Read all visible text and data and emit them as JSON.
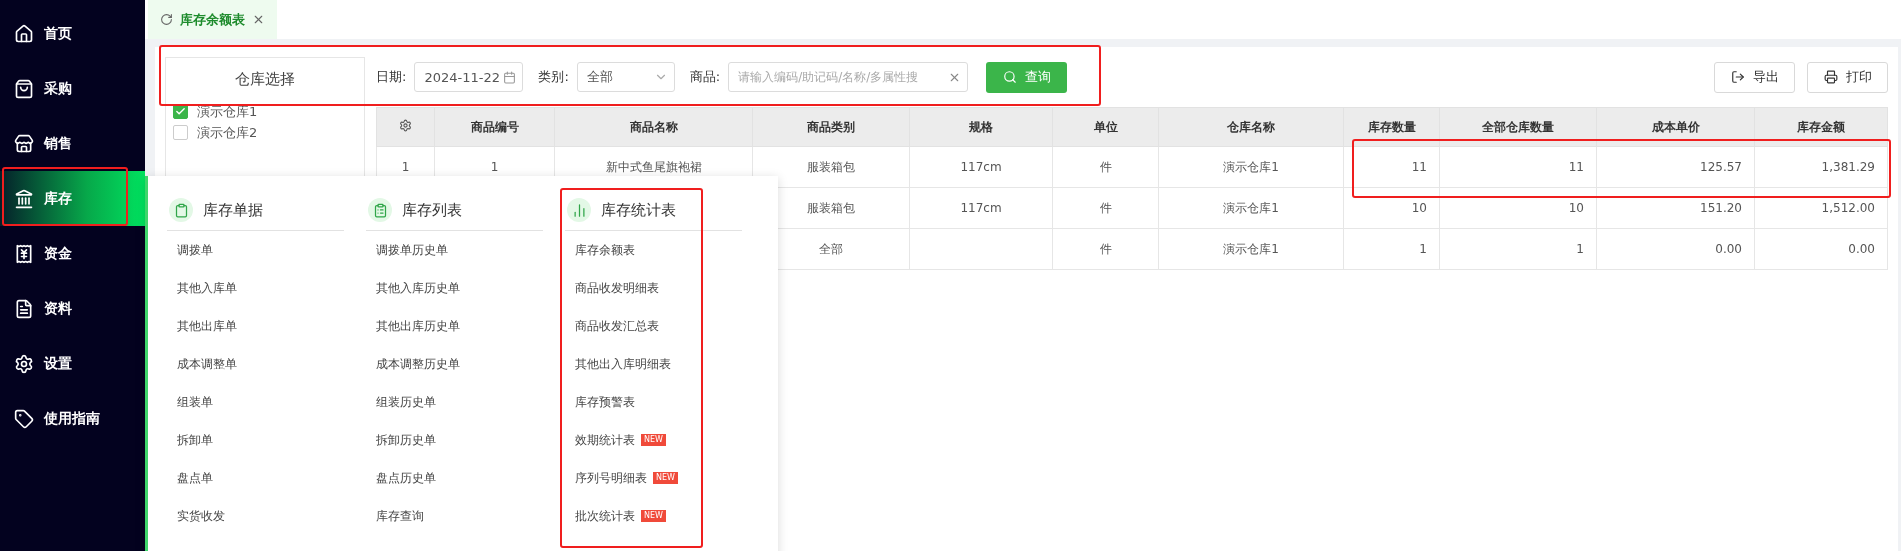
{
  "sidebar": {
    "items": [
      {
        "label": "首页",
        "selected": false
      },
      {
        "label": "采购",
        "selected": false
      },
      {
        "label": "销售",
        "selected": false
      },
      {
        "label": "库存",
        "selected": true
      },
      {
        "label": "资金",
        "selected": false
      },
      {
        "label": "资料",
        "selected": false
      },
      {
        "label": "设置",
        "selected": false
      },
      {
        "label": "使用指南",
        "selected": false
      }
    ]
  },
  "tabs": [
    {
      "label": "库存余额表",
      "selected": true
    }
  ],
  "warehouse_panel": {
    "title": "仓库选择",
    "items": [
      {
        "label": "演示仓库1",
        "checked": true
      },
      {
        "label": "演示仓库2",
        "checked": false
      }
    ]
  },
  "filters": {
    "date_label": "日期:",
    "date_value": "2024-11-22",
    "category_label": "类别:",
    "category_value": "全部",
    "product_label": "商品:",
    "product_placeholder": "请输入编码/助记码/名称/多属性搜"
  },
  "buttons": {
    "search": "查询",
    "export": "导出",
    "print": "打印"
  },
  "table": {
    "columns": [
      "商品编号",
      "商品名称",
      "商品类别",
      "规格",
      "单位",
      "仓库名称",
      "库存数量",
      "全部仓库数量",
      "成本单价",
      "库存金额"
    ],
    "rows": [
      {
        "row_number": "1",
        "cells": [
          "1",
          "新中式鱼尾旗袍裙",
          "服装箱包",
          "117cm",
          "件",
          "演示仓库1",
          "11",
          "11",
          "125.57",
          "1,381.29"
        ]
      },
      {
        "cells": [
          null,
          null,
          "服装箱包",
          "117cm",
          "件",
          "演示仓库1",
          "10",
          "10",
          "151.20",
          "1,512.00"
        ]
      },
      {
        "cells": [
          null,
          null,
          "全部",
          null,
          "件",
          "演示仓库1",
          "1",
          "1",
          "0.00",
          "0.00"
        ]
      }
    ]
  },
  "menu": {
    "sections": [
      {
        "title": "库存单据",
        "items": [
          {
            "label": "调拨单"
          },
          {
            "label": "其他入库单"
          },
          {
            "label": "其他出库单"
          },
          {
            "label": "成本调整单"
          },
          {
            "label": "组装单"
          },
          {
            "label": "拆卸单"
          },
          {
            "label": "盘点单"
          },
          {
            "label": "实货收发"
          }
        ]
      },
      {
        "title": "库存列表",
        "items": [
          {
            "label": "调拨单历史单"
          },
          {
            "label": "其他入库历史单"
          },
          {
            "label": "其他出库历史单"
          },
          {
            "label": "成本调整历史单"
          },
          {
            "label": "组装历史单"
          },
          {
            "label": "拆卸历史单"
          },
          {
            "label": "盘点历史单"
          },
          {
            "label": "库存查询"
          }
        ]
      },
      {
        "title": "库存统计表",
        "items": [
          {
            "label": "库存余额表"
          },
          {
            "label": "商品收发明细表"
          },
          {
            "label": "商品收发汇总表"
          },
          {
            "label": "其他出入库明细表"
          },
          {
            "label": "库存预警表"
          },
          {
            "label": "效期统计表",
            "badge": "NEW"
          },
          {
            "label": "序列号明细表",
            "badge": "NEW"
          },
          {
            "label": "批次统计表",
            "badge": "NEW"
          }
        ]
      }
    ]
  }
}
